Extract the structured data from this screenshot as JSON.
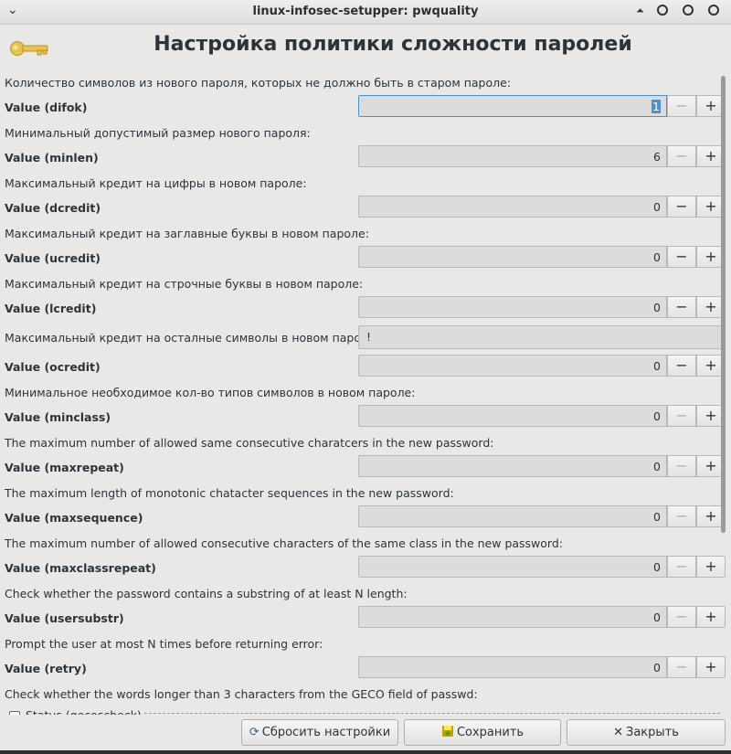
{
  "window": {
    "title": "linux-infosec-setupper: pwquality",
    "menu_glyph": "⌄",
    "shade_glyph": "⏶"
  },
  "header": {
    "icon": "key-icon",
    "title": "Настройка политики сложности паролей"
  },
  "rows": [
    {
      "desc": "Количество символов из нового пароля, которых не должно быть в старом пароле:",
      "label": "Value (difok)",
      "value": "1",
      "minus_enabled": false
    },
    {
      "desc": "Минимальный допустимый размер нового пароля:",
      "label": "Value (minlen)",
      "value": "6",
      "minus_enabled": false
    },
    {
      "desc": "Максимальный кредит на цифры в новом пароле:",
      "label": "Value (dcredit)",
      "value": "0",
      "minus_enabled": true
    },
    {
      "desc": "Максимальный кредит на заглавные буквы в новом пароле:",
      "label": "Value (ucredit)",
      "value": "0",
      "minus_enabled": true
    },
    {
      "desc": "Максимальный кредит на строчные буквы в новом пароле:",
      "label": "Value (lcredit)",
      "value": "0",
      "minus_enabled": true
    },
    {
      "desc": "Максимальный кредит на осталные символы в новом пароле",
      "text_value": "!",
      "label": "Value (ocredit)",
      "value": "0",
      "minus_enabled": true
    },
    {
      "desc": "Минимальное необходимое кол-во типов символов в новом пароле:",
      "label": "Value (minclass)",
      "value": "0",
      "minus_enabled": false
    },
    {
      "desc": "The maximum number of allowed same consecutive charatcers in the new password:",
      "label": "Value (maxrepeat)",
      "value": "0",
      "minus_enabled": false
    },
    {
      "desc": "The maximum length of monotonic chatacter sequences in the new password:",
      "label": "Value (maxsequence)",
      "value": "0",
      "minus_enabled": false
    },
    {
      "desc": "The maximum number of allowed consecutive characters of the same class in the new password:",
      "label": "Value (maxclassrepeat)",
      "value": "0",
      "minus_enabled": false
    },
    {
      "desc": "Check whether the password contains a substring of at least N length:",
      "label": "Value (usersubstr)",
      "value": "0",
      "minus_enabled": false
    },
    {
      "desc": "Prompt the user at most N times before returning error:",
      "label": "Value (retry)",
      "value": "0",
      "minus_enabled": false
    },
    {
      "desc": "Check whether the words longer than 3 characters from the GECO field of passwd:"
    }
  ],
  "partial_checkbox_label": "Status (gecoscheck)",
  "spin": {
    "minus": "−",
    "plus": "+"
  },
  "buttons": {
    "reset": "Сбросить настройки",
    "save": "Сохранить",
    "close": "Закрыть",
    "close_glyph": "✕"
  },
  "colors": {
    "accent": "#4a90d9",
    "background": "#e8e8e7",
    "key_icon": "#e9c44a"
  }
}
